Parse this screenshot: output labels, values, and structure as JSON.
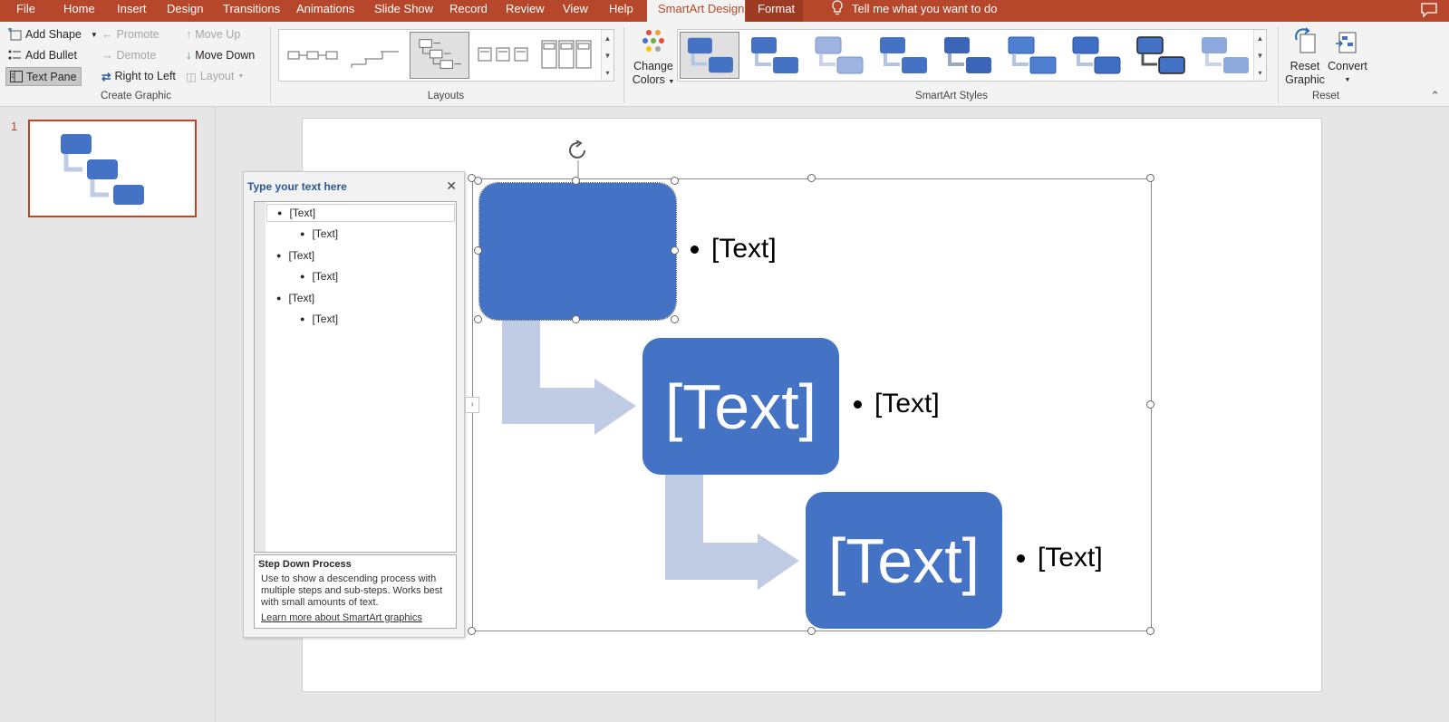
{
  "menubar": {
    "tabs": [
      "File",
      "Home",
      "Insert",
      "Design",
      "Transitions",
      "Animations",
      "Slide Show",
      "Record",
      "Review",
      "View",
      "Help",
      "SmartArt Design",
      "Format"
    ],
    "tell_me": "Tell me what you want to do"
  },
  "ribbon": {
    "create_graphic": {
      "add_shape": "Add Shape",
      "add_bullet": "Add Bullet",
      "text_pane": "Text Pane",
      "promote": "Promote",
      "demote": "Demote",
      "right_to_left": "Right to Left",
      "move_up": "Move Up",
      "move_down": "Move Down",
      "layout": "Layout",
      "label": "Create Graphic"
    },
    "layouts": {
      "label": "Layouts"
    },
    "change_colors": {
      "line1": "Change",
      "line2": "Colors"
    },
    "smartart_styles": {
      "label": "SmartArt Styles"
    },
    "reset": {
      "reset_graphic_1": "Reset",
      "reset_graphic_2": "Graphic",
      "convert": "Convert",
      "label": "Reset"
    }
  },
  "thumbnails": {
    "slide_number": "1"
  },
  "text_pane": {
    "title": "Type your text here",
    "lines": [
      {
        "level": 1,
        "text": "[Text]"
      },
      {
        "level": 2,
        "text": "[Text]"
      },
      {
        "level": 1,
        "text": "[Text]"
      },
      {
        "level": 2,
        "text": "[Text]"
      },
      {
        "level": 1,
        "text": "[Text]"
      },
      {
        "level": 2,
        "text": "[Text]"
      }
    ],
    "desc_title": "Step Down Process",
    "desc_text": "Use to show a descending process with multiple steps and sub-steps. Works best with small amounts of text.",
    "desc_link": "Learn more about SmartArt graphics"
  },
  "smartart": {
    "shapes": [
      {
        "text": "",
        "bullet": "[Text]"
      },
      {
        "text": "[Text]",
        "bullet": "[Text]"
      },
      {
        "text": "[Text]",
        "bullet": "[Text]"
      }
    ],
    "colors": {
      "shape": "#4472c4",
      "arrow": "#c0cbe4",
      "accent": "#b7472a"
    }
  }
}
